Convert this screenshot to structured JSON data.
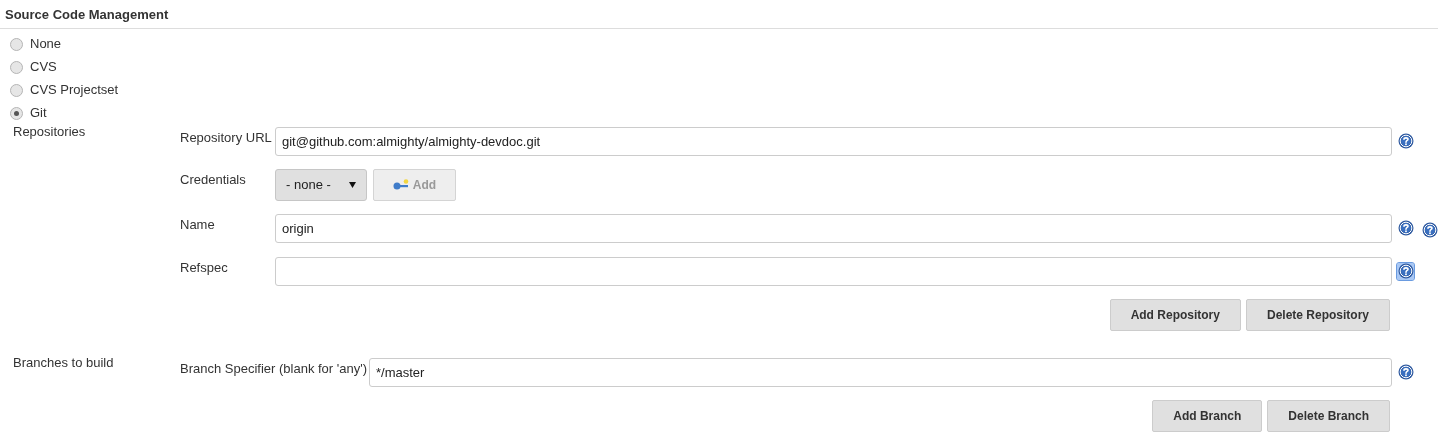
{
  "section": {
    "title": "Source Code Management"
  },
  "scm_options": [
    {
      "label": "None",
      "selected": false
    },
    {
      "label": "CVS",
      "selected": false
    },
    {
      "label": "CVS Projectset",
      "selected": false
    },
    {
      "label": "Git",
      "selected": true
    }
  ],
  "repositories": {
    "label": "Repositories",
    "fields": [
      {
        "kind": "text",
        "label": "Repository URL",
        "value": "git@github.com:almighty/almighty-devdoc.git",
        "help_focused": false,
        "outer_help": false
      },
      {
        "kind": "select",
        "label": "Credentials",
        "value": "- none -",
        "add_button": {
          "label": "Add",
          "disabled": true
        }
      },
      {
        "kind": "text",
        "label": "Name",
        "value": "origin",
        "help_focused": false,
        "outer_help": true
      },
      {
        "kind": "text",
        "label": "Refspec",
        "help_focused": true,
        "outer_help": false
      }
    ],
    "buttons": [
      "Add Repository",
      "Delete Repository"
    ]
  },
  "branches": {
    "label": "Branches to build",
    "specifier_label": "Branch Specifier (blank for 'any')",
    "value": "*/master",
    "buttons": [
      "Add Branch",
      "Delete Branch"
    ]
  }
}
